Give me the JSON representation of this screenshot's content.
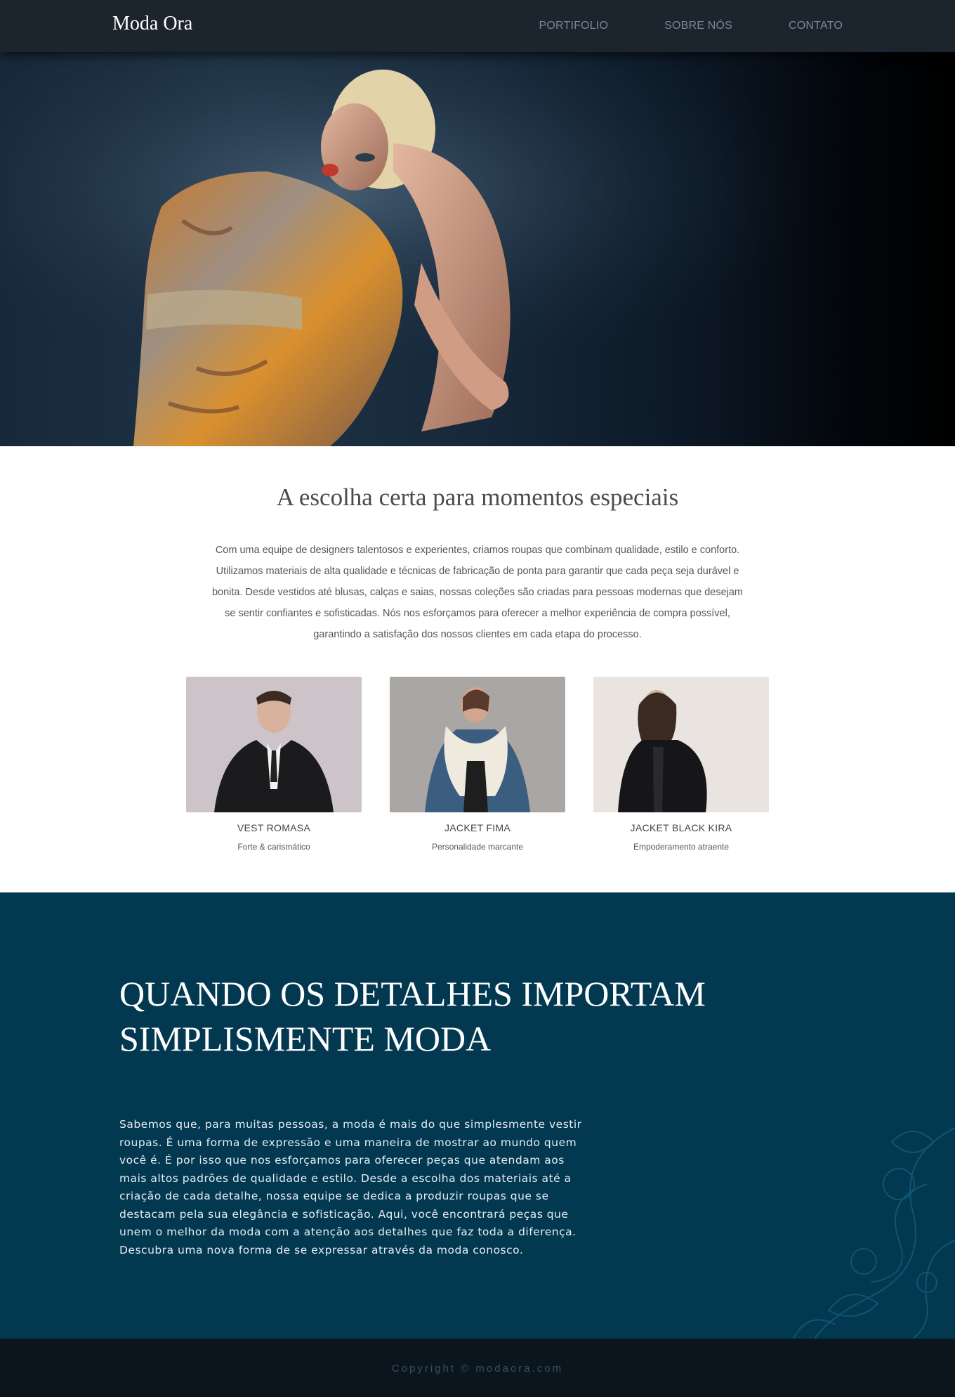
{
  "navbar": {
    "brand": "Moda Ora",
    "links": [
      "PORTIFOLIO",
      "SOBRE NÓS",
      "CONTATO"
    ]
  },
  "intro": {
    "title": "A escolha certa para momentos especiais",
    "text": "Com uma equipe de designers talentosos e experientes, criamos roupas que combinam qualidade, estilo e conforto. Utilizamos materiais de alta qualidade e técnicas de fabricação de ponta para garantir que cada peça seja durável e bonita. Desde vestidos até blusas, calças e saias, nossas coleções são criadas para pessoas modernas que desejam se sentir confiantes e sofisticadas. Nós nos esforçamos para oferecer a melhor experiência de compra possível, garantindo a satisfação dos nossos clientes em cada etapa do processo."
  },
  "products": [
    {
      "name": "VEST ROMASA",
      "description": "Forte & carismático"
    },
    {
      "name": "JACKET FIMA",
      "description": "Personalidade marcante"
    },
    {
      "name": "JACKET BLACK KIRA",
      "description": "Empoderamento atraente"
    }
  ],
  "feature": {
    "title_line1": "QUANDO OS DETALHES IMPORTAM",
    "title_line2": "SIMPLISMENTE MODA",
    "text": "Sabemos que, para muitas pessoas, a moda é mais do que simplesmente vestir roupas. É uma forma de expressão e uma maneira de mostrar ao mundo quem você é. É por isso que nos esforçamos para oferecer peças que atendam aos mais altos padrões de qualidade e estilo. Desde a escolha dos materiais até a criação de cada detalhe, nossa equipe se dedica a produzir roupas que se destacam pela sua elegância e sofisticação. Aqui, você encontrará peças que unem o melhor da moda com a atenção aos detalhes que faz toda a diferença. Descubra uma nova forma de se expressar através da moda conosco."
  },
  "footer": {
    "copyright": "Copyright © modaora.com"
  },
  "colors": {
    "navbar": "#1c252e",
    "feature_bg": "#023850",
    "footer_bg": "#0a151e"
  }
}
